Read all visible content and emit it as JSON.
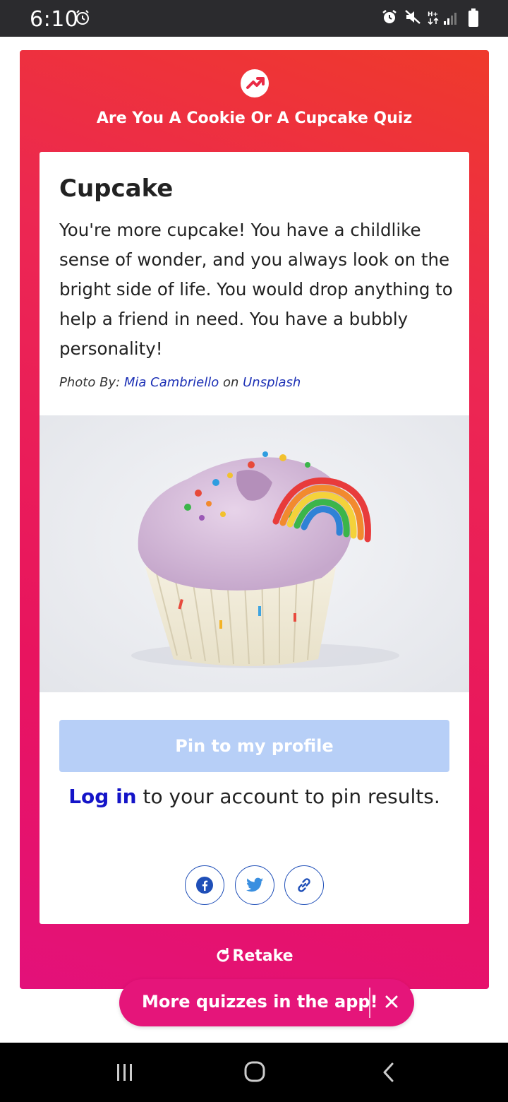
{
  "status_bar": {
    "time": "6:10",
    "icons": [
      "alarm-icon",
      "mute-icon",
      "data-arrows-icon",
      "signal-icon",
      "battery-icon"
    ]
  },
  "quiz": {
    "title": "Are You A Cookie Or A Cupcake Quiz",
    "result_title": "Cupcake",
    "result_description": "You're more cupcake! You have a childlike sense of wonder, and you always look on the bright side of life. You would drop anything to help a friend in need. You have a bubbly personality!",
    "credit_prefix": "Photo By:",
    "credit_author": "Mia Cambriello",
    "credit_on": "on",
    "credit_source": "Unsplash",
    "pin_label": "Pin to my profile",
    "login_link": "Log in",
    "login_rest": " to your account to pin results.",
    "share_buttons": [
      "facebook-icon",
      "twitter-icon",
      "link-icon"
    ],
    "retake_label": "Retake"
  },
  "app_banner": {
    "label": "More quizzes in the app!"
  },
  "colors": {
    "card_gradient_top": "#ef3a2b",
    "card_gradient_bottom": "#e3117a",
    "pin_button_disabled": "#b7cff7",
    "link_blue": "#1414c8",
    "share_border": "#1f4fb8"
  }
}
